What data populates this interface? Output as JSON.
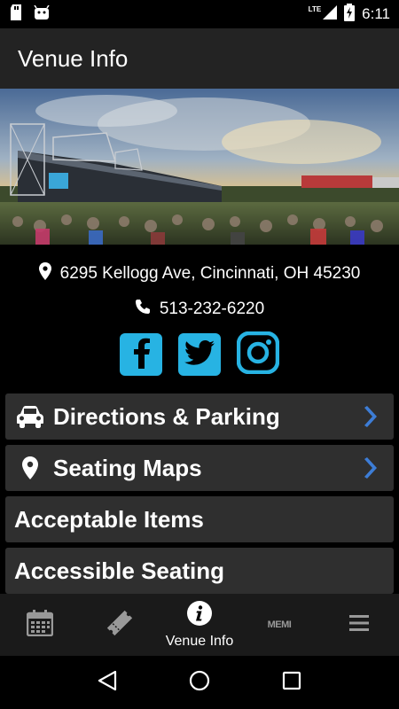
{
  "status_bar": {
    "time": "6:11",
    "network": "LTE",
    "icons": [
      "sd-card-icon",
      "android-icon",
      "signal-icon",
      "battery-charging-icon"
    ]
  },
  "app_bar": {
    "title": "Venue Info"
  },
  "venue": {
    "address": "6295 Kellogg Ave, Cincinnati, OH 45230",
    "phone": "513-232-6220"
  },
  "social": [
    {
      "name": "facebook",
      "icon": "facebook-icon",
      "color": "#27b3e3"
    },
    {
      "name": "twitter",
      "icon": "twitter-icon",
      "color": "#27b3e3"
    },
    {
      "name": "instagram",
      "icon": "instagram-icon",
      "color": "#27b3e3"
    }
  ],
  "menu": {
    "items": [
      {
        "label": "Directions & Parking",
        "icon": "car-icon",
        "has_chevron": true
      },
      {
        "label": "Seating Maps",
        "icon": "map-pin-icon",
        "has_chevron": true
      },
      {
        "label": "Acceptable Items",
        "icon": "",
        "has_chevron": false
      },
      {
        "label": "Accessible Seating",
        "icon": "",
        "has_chevron": false
      }
    ]
  },
  "bottom_nav": {
    "items": [
      {
        "label": "",
        "icon": "calendar-icon"
      },
      {
        "label": "",
        "icon": "ticket-icon"
      },
      {
        "label": "Venue Info",
        "icon": "info-icon",
        "active": true
      },
      {
        "label": "MEMI",
        "icon": "memi-logo"
      },
      {
        "label": "",
        "icon": "hamburger-menu-icon"
      }
    ]
  },
  "colors": {
    "accent": "#27b3e3",
    "chevron": "#3d7dd6",
    "app_bar": "#232323",
    "menu_item": "#2f2f2f",
    "bottom_nav": "#1a1a1a"
  }
}
